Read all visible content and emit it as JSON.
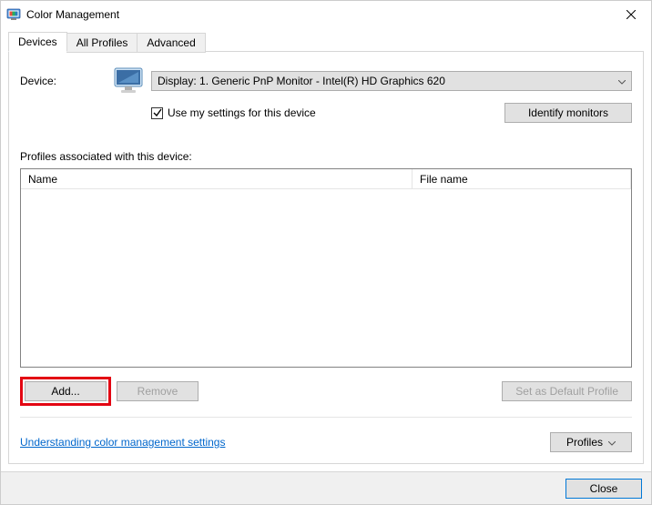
{
  "window": {
    "title": "Color Management"
  },
  "tabs": {
    "devices": "Devices",
    "all_profiles": "All Profiles",
    "advanced": "Advanced"
  },
  "device": {
    "label": "Device:",
    "selected": "Display: 1. Generic PnP Monitor - Intel(R) HD Graphics 620",
    "use_settings_label": "Use my settings for this device",
    "use_settings_checked": true,
    "identify_label": "Identify monitors"
  },
  "profiles": {
    "section_label": "Profiles associated with this device:",
    "col_name": "Name",
    "col_file": "File name"
  },
  "buttons": {
    "add": "Add...",
    "remove": "Remove",
    "set_default": "Set as Default Profile",
    "profiles": "Profiles"
  },
  "link": {
    "understanding": "Understanding color management settings"
  },
  "footer": {
    "close": "Close"
  }
}
